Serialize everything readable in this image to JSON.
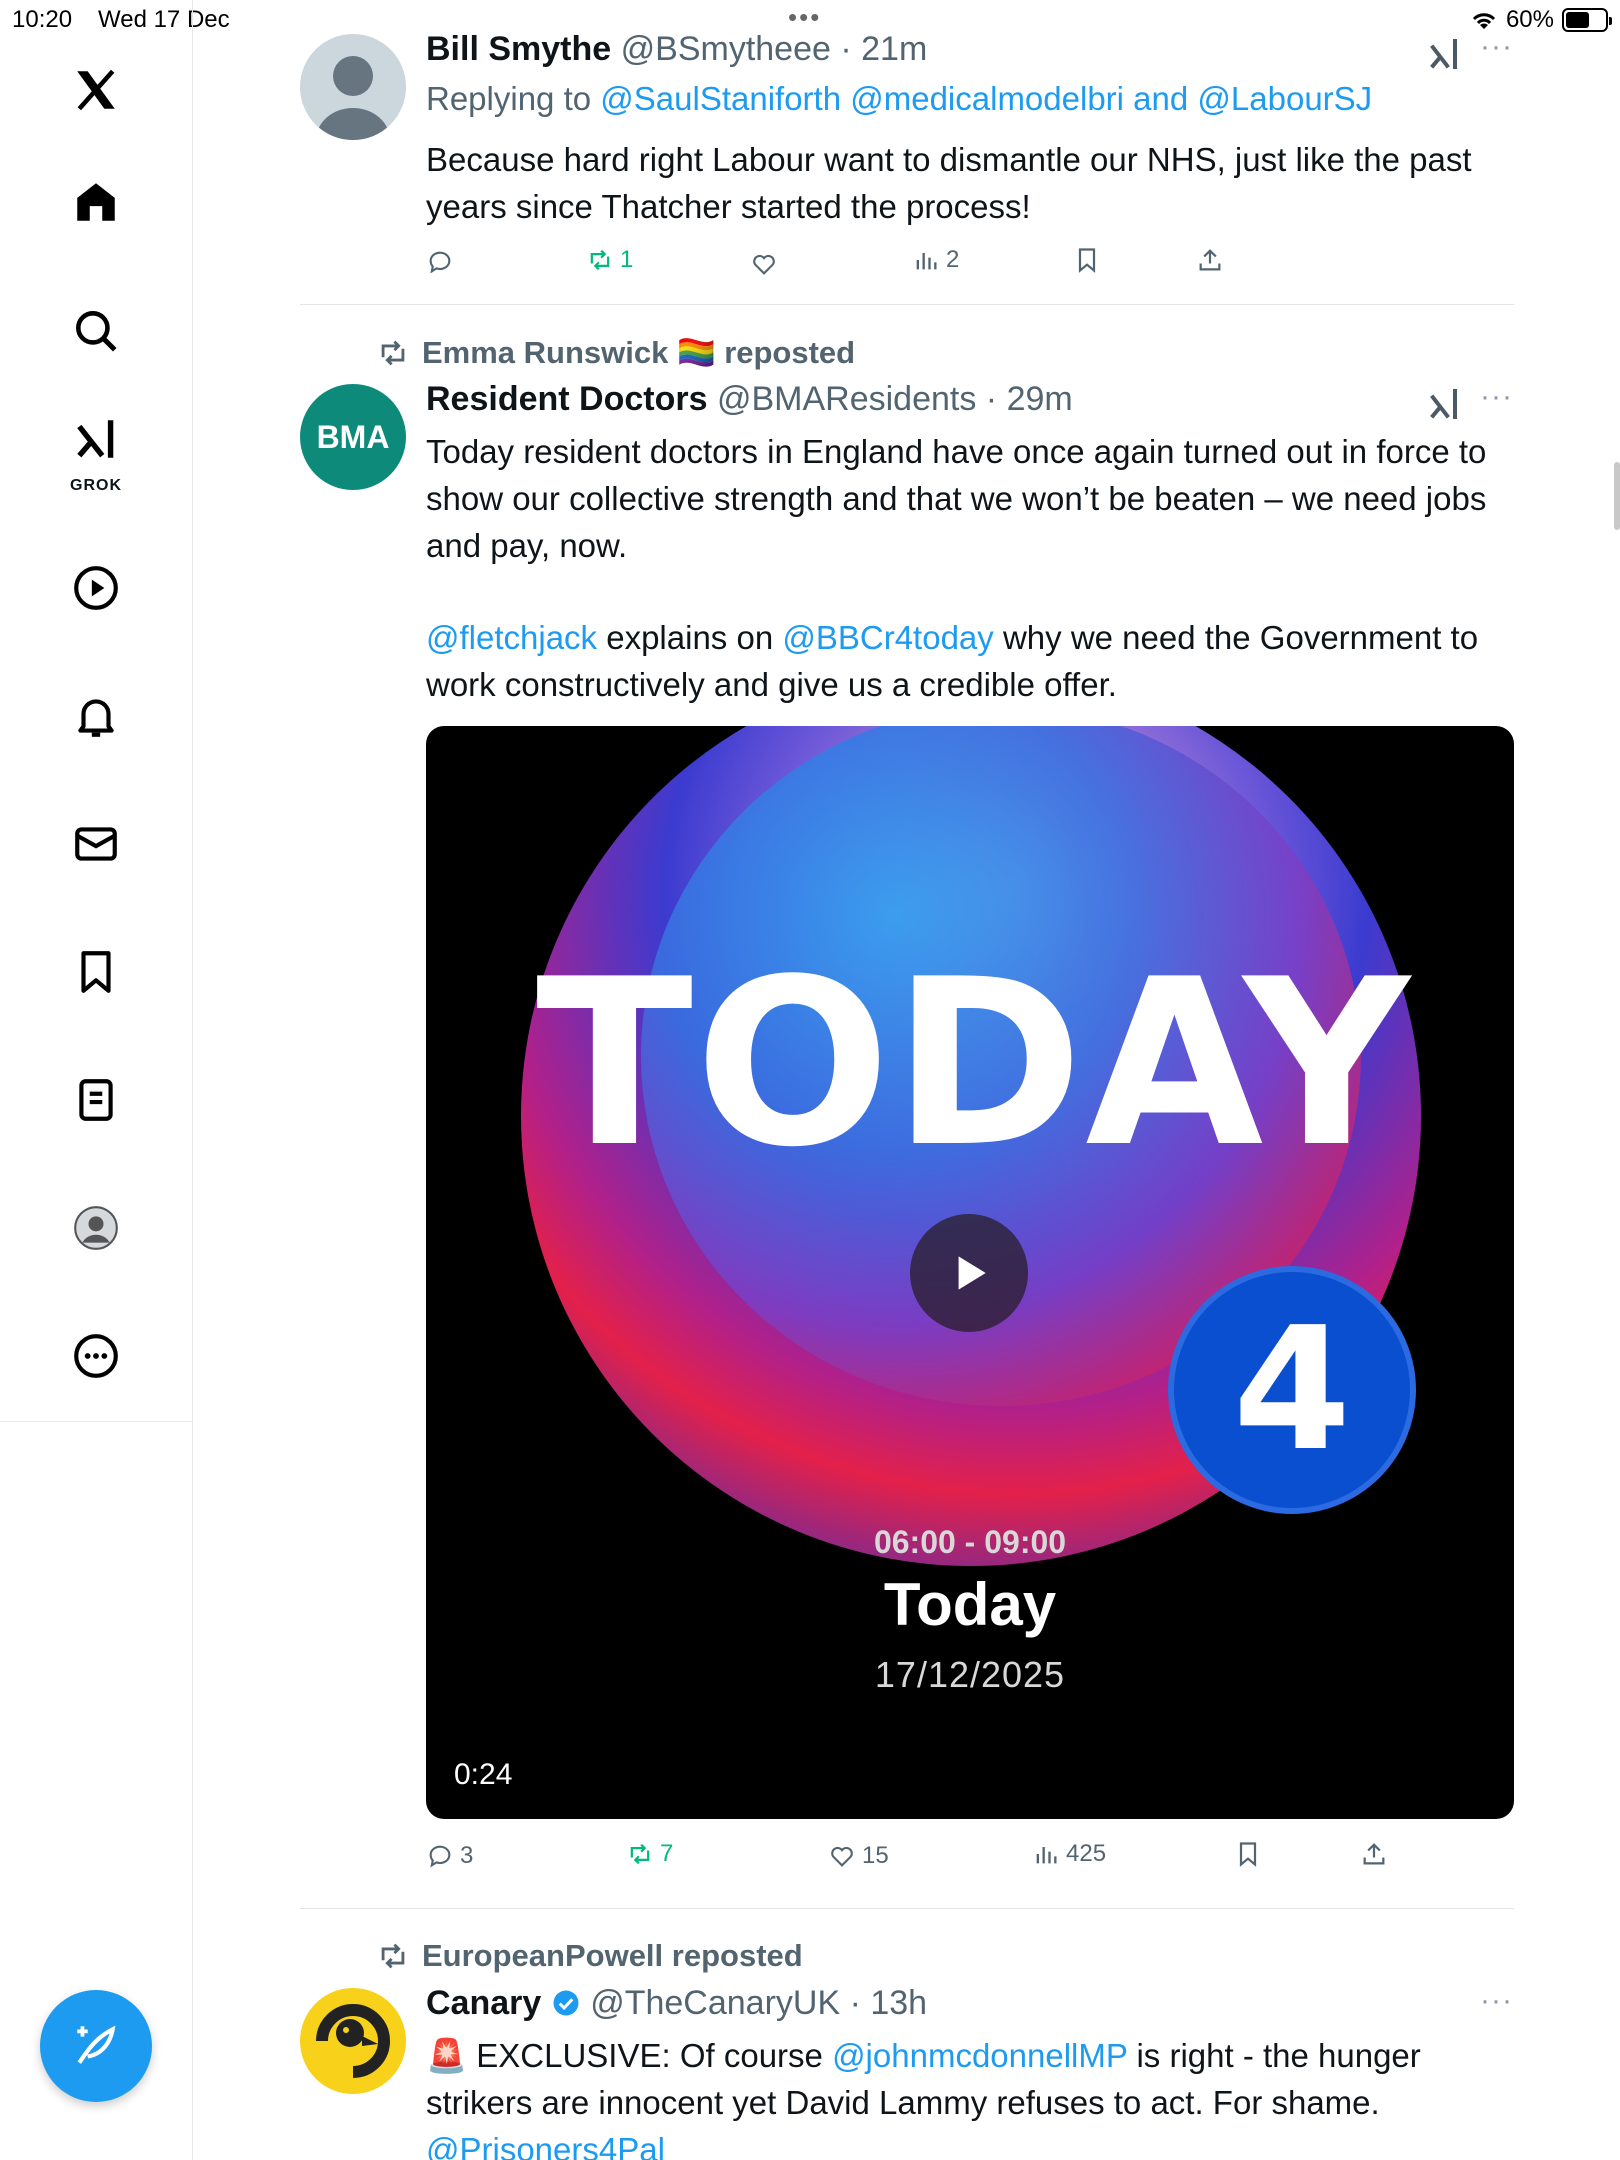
{
  "status": {
    "time": "10:20",
    "date": "Wed 17 Dec",
    "battery": "60%",
    "battery_level": 0.6
  },
  "sidebar": {
    "grok_label": "GROK",
    "icons": [
      "x-logo-icon",
      "home-icon",
      "search-icon",
      "grok-icon",
      "video-icon",
      "notifications-icon",
      "messages-icon",
      "bookmarks-icon",
      "lists-icon",
      "profile-icon",
      "more-icon"
    ]
  },
  "tweets": [
    {
      "name": "Bill Smythe",
      "handle": "@BSmytheee",
      "time": "21m",
      "replying_prefix": "Replying to ",
      "replying_1": "@SaulStaniforth",
      "replying_2": "@medicalmodelbri",
      "replying_and": " and ",
      "replying_3": "@LabourSJ",
      "text": "Because hard right Labour want to dismantle our NHS, just like the past years since Thatcher started the process!",
      "reposts": "1",
      "views": "2"
    },
    {
      "reposted_by": "Emma Runswick 🏳️‍🌈 reposted",
      "name": "Resident Doctors",
      "handle": "@BMAResidents",
      "time": "29m",
      "avatar_label": "BMA",
      "text_1": "Today resident doctors in England have once again turned out in force to show our collective strength and that we won’t be beaten – we need jobs and pay, now.",
      "mention_1": "@fletchjack",
      "text_2": " explains on ",
      "mention_2": "@BBCr4today",
      "text_3": " why we need the Government to work constructively and give us a credible offer.",
      "video": {
        "logo_word": "TODAY",
        "logo_number": "4",
        "time_slot": "06:00 - 09:00",
        "title": "Today",
        "date": "17/12/2025",
        "duration": "0:24"
      },
      "replies": "3",
      "reposts": "7",
      "likes": "15",
      "views": "425"
    },
    {
      "reposted_by": "EuropeanPowell reposted",
      "name": "Canary",
      "handle": "@TheCanaryUK",
      "time": "13h",
      "emoji": "🚨",
      "text_1": " EXCLUSIVE: Of course ",
      "mention_1": "@johnmcdonnellMP",
      "text_2": " is right - the hunger strikers are innocent yet David Lammy refuses to act. For shame.",
      "mention_2": "@Prisoners4Pal"
    }
  ]
}
